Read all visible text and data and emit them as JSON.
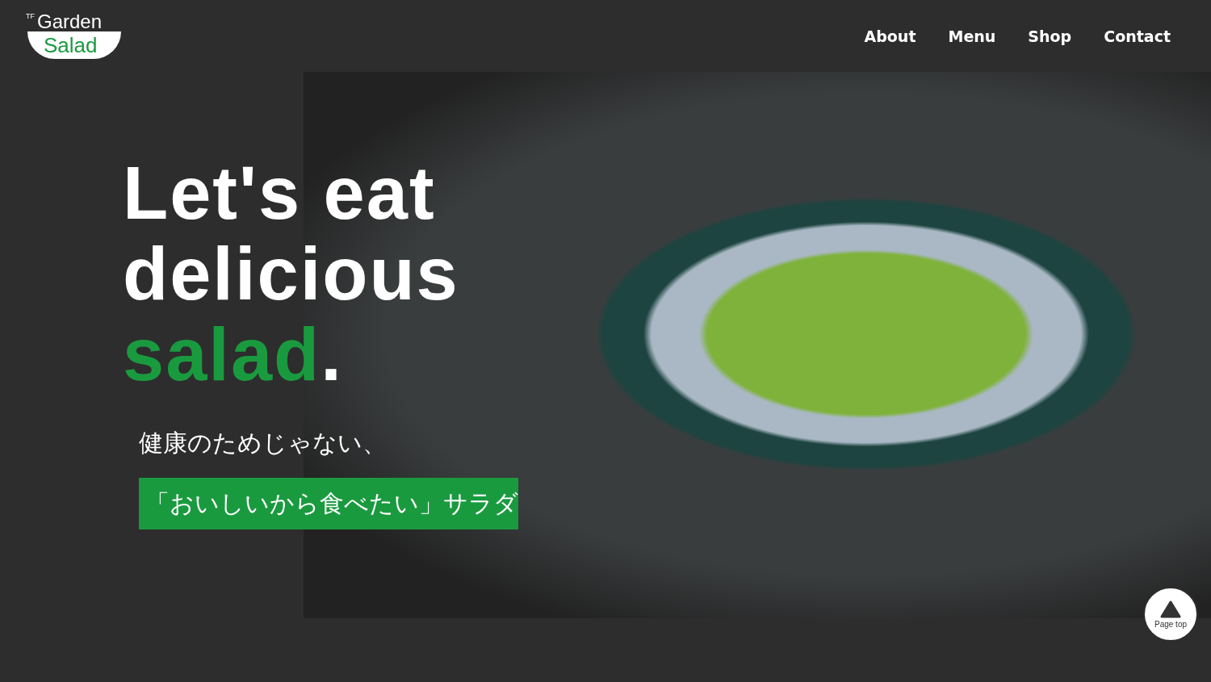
{
  "logo": {
    "superscript": "TF",
    "top": "Garden",
    "bottom": "Salad"
  },
  "nav": [
    "About",
    "Menu",
    "Shop",
    "Contact"
  ],
  "hero": {
    "headline_lines": [
      "Let's eat",
      "delicious"
    ],
    "headline_accent": "salad",
    "headline_end": ".",
    "tagline": "健康のためじゃない、",
    "highlight": "「おいしいから食べたい」サラダ"
  },
  "page_top": {
    "label": "Page top"
  }
}
